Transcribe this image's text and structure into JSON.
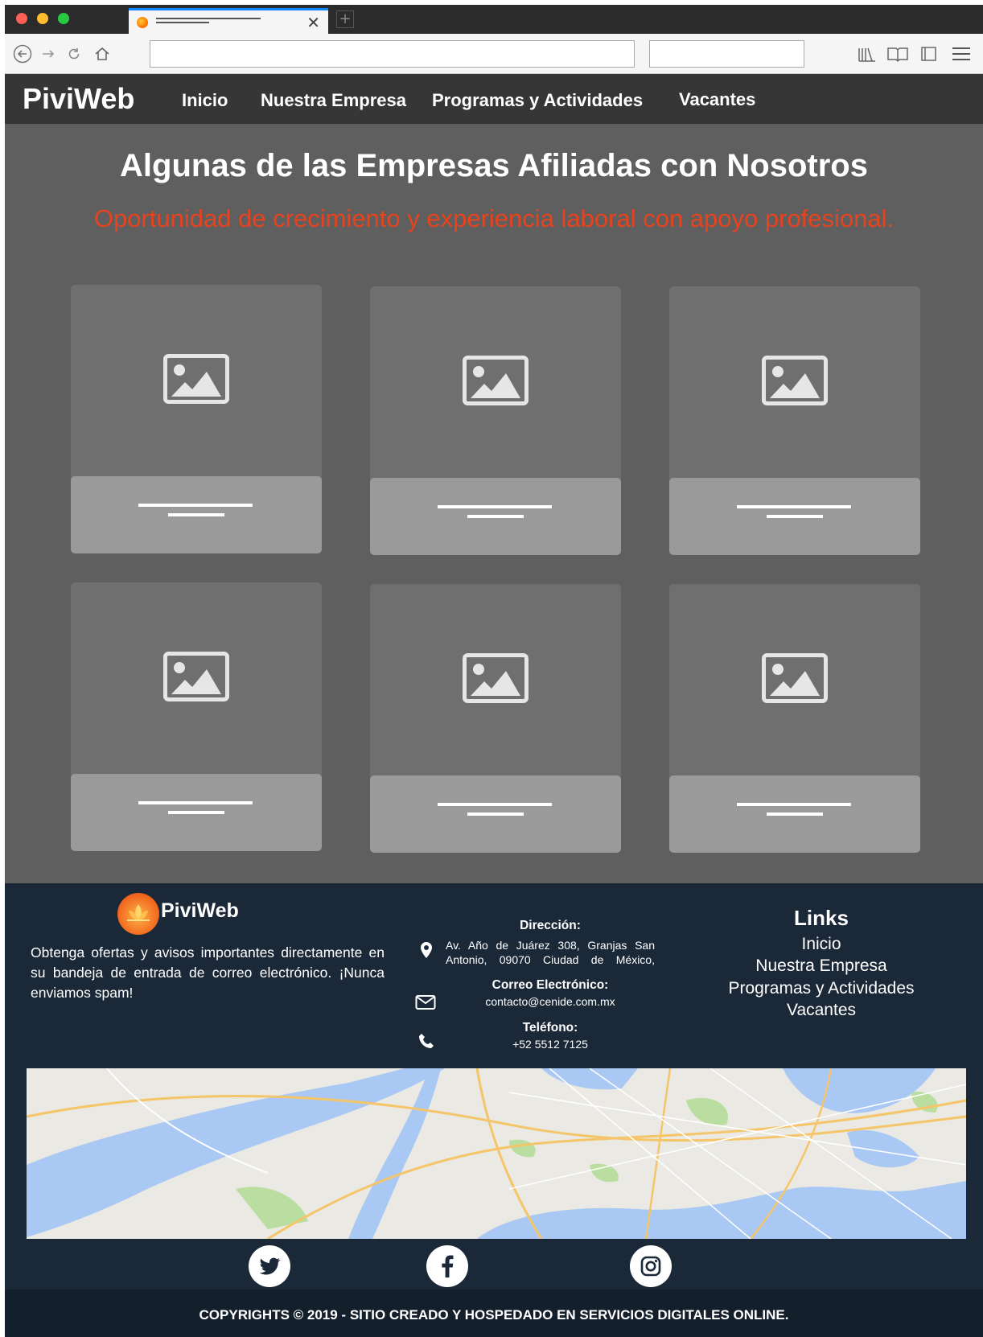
{
  "browser": {
    "tab_close": "✕",
    "new_tab": "+",
    "nav_icons": [
      "back-icon",
      "forward-icon",
      "reload-icon",
      "home-icon"
    ],
    "toolbar_icons": [
      "library-icon",
      "reader-icon",
      "sidebar-icon",
      "menu-icon"
    ],
    "url_value": "",
    "search_value": ""
  },
  "nav": {
    "brand": "PiviWeb",
    "links": [
      "Inicio",
      "Nuestra Empresa",
      "Programas y Actividades",
      "Vacantes"
    ]
  },
  "hero": {
    "title": "Algunas de las Empresas Afiliadas con Nosotros",
    "subtitle": "Oportunidad de crecimiento y experiencia laboral con apoyo profesional."
  },
  "cards": [
    {
      "icon": "image-placeholder-icon"
    },
    {
      "icon": "image-placeholder-icon"
    },
    {
      "icon": "image-placeholder-icon"
    },
    {
      "icon": "image-placeholder-icon"
    },
    {
      "icon": "image-placeholder-icon"
    },
    {
      "icon": "image-placeholder-icon"
    }
  ],
  "footer": {
    "brand": "PiviWeb",
    "newsletter_text": "Obtenga ofertas y avisos importantes directamente en su bandeja de entrada de correo electrónico. ¡Nunca enviamos spam!",
    "address_label": "Dirección:",
    "address_value": "Av. Año de Juárez 308, Granjas San Antonio, 09070 Ciudad de México,",
    "email_label": "Correo Electrónico:",
    "email_value": "contacto@cenide.com.mx",
    "phone_label": "Teléfono:",
    "phone_value": "+52 5512 7125",
    "links_title": "Links",
    "links": [
      "Inicio",
      "Nuestra Empresa",
      "Programas y Actividades",
      "Vacantes"
    ],
    "social": [
      "twitter-icon",
      "facebook-icon",
      "instagram-icon"
    ],
    "copyright": "COPYRIGHTS © 2019 - SITIO CREADO Y HOSPEDADO EN SERVICIOS DIGITALES ONLINE."
  },
  "colors": {
    "nav_bg": "#363636",
    "section_bg": "#5f5f5f",
    "card_bg": "#6f6f6f",
    "card_footer_bg": "#9a9a9a",
    "subtitle": "#e8421e",
    "footer_bg": "#1b2838",
    "copyright_bg": "#131f2b"
  }
}
